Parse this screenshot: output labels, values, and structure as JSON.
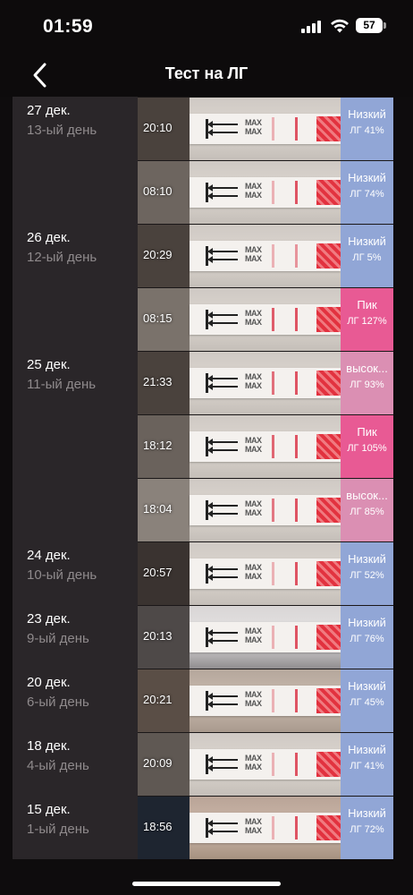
{
  "status_bar": {
    "time": "01:59",
    "battery": "57"
  },
  "header": {
    "title": "Тест на ЛГ"
  },
  "days": [
    {
      "date": "27 дек.",
      "day": "13-ый день"
    },
    {
      "date": "26 дек.",
      "day": "12-ый день"
    },
    {
      "date": "25 дек.",
      "day": "11-ый день"
    },
    {
      "date": "24 дек.",
      "day": "10-ый день"
    },
    {
      "date": "23 дек.",
      "day": "9-ый день"
    },
    {
      "date": "20 дек.",
      "day": "6-ый день"
    },
    {
      "date": "18 дек.",
      "day": "4-ый день"
    },
    {
      "date": "15 дек.",
      "day": "1-ый день"
    }
  ],
  "tests": [
    {
      "time": "20:10",
      "level": "Низкий",
      "value": "ЛГ 41%",
      "type": "low"
    },
    {
      "time": "08:10",
      "level": "Низкий",
      "value": "ЛГ 74%",
      "type": "low"
    },
    {
      "time": "20:29",
      "level": "Низкий",
      "value": "ЛГ 5%",
      "type": "low"
    },
    {
      "time": "08:15",
      "level": "Пик",
      "value": "ЛГ 127%",
      "type": "peak"
    },
    {
      "time": "21:33",
      "level": "высок...",
      "value": "ЛГ 93%",
      "type": "high"
    },
    {
      "time": "18:12",
      "level": "Пик",
      "value": "ЛГ 105%",
      "type": "peak"
    },
    {
      "time": "18:04",
      "level": "высок...",
      "value": "ЛГ 85%",
      "type": "high"
    },
    {
      "time": "20:57",
      "level": "Низкий",
      "value": "ЛГ 52%",
      "type": "low"
    },
    {
      "time": "20:13",
      "level": "Низкий",
      "value": "ЛГ 76%",
      "type": "low"
    },
    {
      "time": "20:21",
      "level": "Низкий",
      "value": "ЛГ 45%",
      "type": "low"
    },
    {
      "time": "20:09",
      "level": "Низкий",
      "value": "ЛГ 41%",
      "type": "low"
    },
    {
      "time": "18:56",
      "level": "Низкий",
      "value": "ЛГ 72%",
      "type": "low"
    }
  ],
  "strip_text": "MAX",
  "colors": {
    "low": "#91a6d6",
    "high": "#db8fb3",
    "peak": "#e85a94"
  }
}
